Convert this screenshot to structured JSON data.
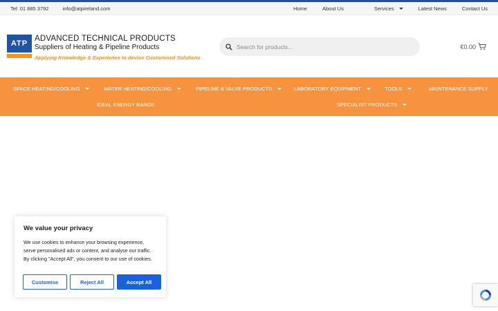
{
  "topbar": {
    "phone": "Tel: 01 885 3792",
    "email": "info@atpireland.com",
    "links": [
      "Home",
      "About Us",
      "Services",
      "Latest News",
      "Contact Us"
    ]
  },
  "logo": {
    "abbr": "ATP",
    "line1": "ADVANCED TECHNICAL PRODUCTS",
    "line2": "Suppliers of Heating & Pipeline Products",
    "line3": "Applying Knowledge & Experience to devise Customised Solutions"
  },
  "search": {
    "placeholder": "Search for products..."
  },
  "cart": {
    "total": "€0.00"
  },
  "nav": {
    "items": [
      "SPACE HEATING/COOLING",
      "WATER HEATING/COOLING",
      "PIPELINE & VALVE PRODUCTS",
      "LABORATORY EQUIPMENT",
      "TOOLS",
      "MAINTENANCE SUPPLY",
      "IDEAL ENERGY RANGE",
      "SPECIALIST PRODUCTS"
    ]
  },
  "cookie": {
    "title": "We value your privacy",
    "body": "We use cookies to enhance your browsing experience, serve personalised ads or content, and analyse our traffic. By clicking \"Accept All\", you consent to our use of cookies.",
    "customise": "Customise",
    "reject": "Reject All",
    "accept": "Accept All"
  },
  "colors": {
    "accent": "#f7933e",
    "brand_blue": "#1f55a5",
    "cookie_button": "#1863dc"
  }
}
